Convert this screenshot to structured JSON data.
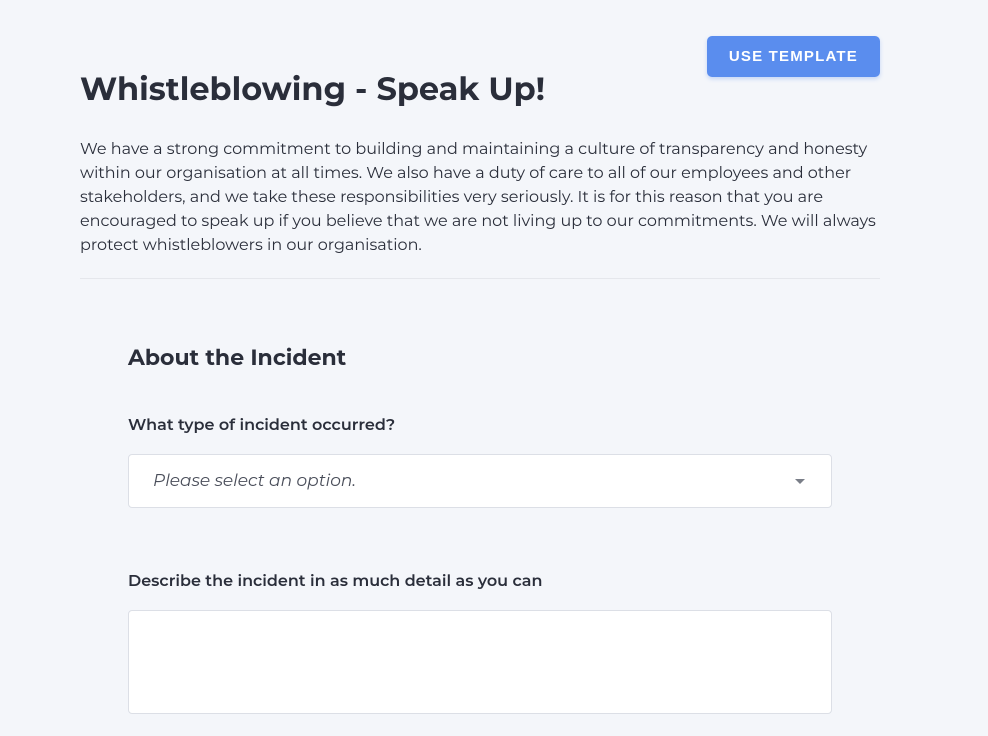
{
  "header": {
    "use_template_button": "USE TEMPLATE"
  },
  "page": {
    "title": "Whistleblowing - Speak Up!",
    "intro": "We have a strong commitment to building and maintaining a culture of transparency and honesty within our organisation at all times. We also have a duty of care to all of our employees and other stakeholders, and we take these responsibilities very seriously. It is for this reason that you are encouraged to speak up if you believe that we are not living up to our commitments. We will always protect whistleblowers in our organisation."
  },
  "form": {
    "section_title": "About the Incident",
    "field_incident_type": {
      "label": "What type of incident occurred?",
      "placeholder": "Please select an option."
    },
    "field_describe": {
      "label": "Describe the incident in as much detail as you can",
      "value": ""
    }
  }
}
